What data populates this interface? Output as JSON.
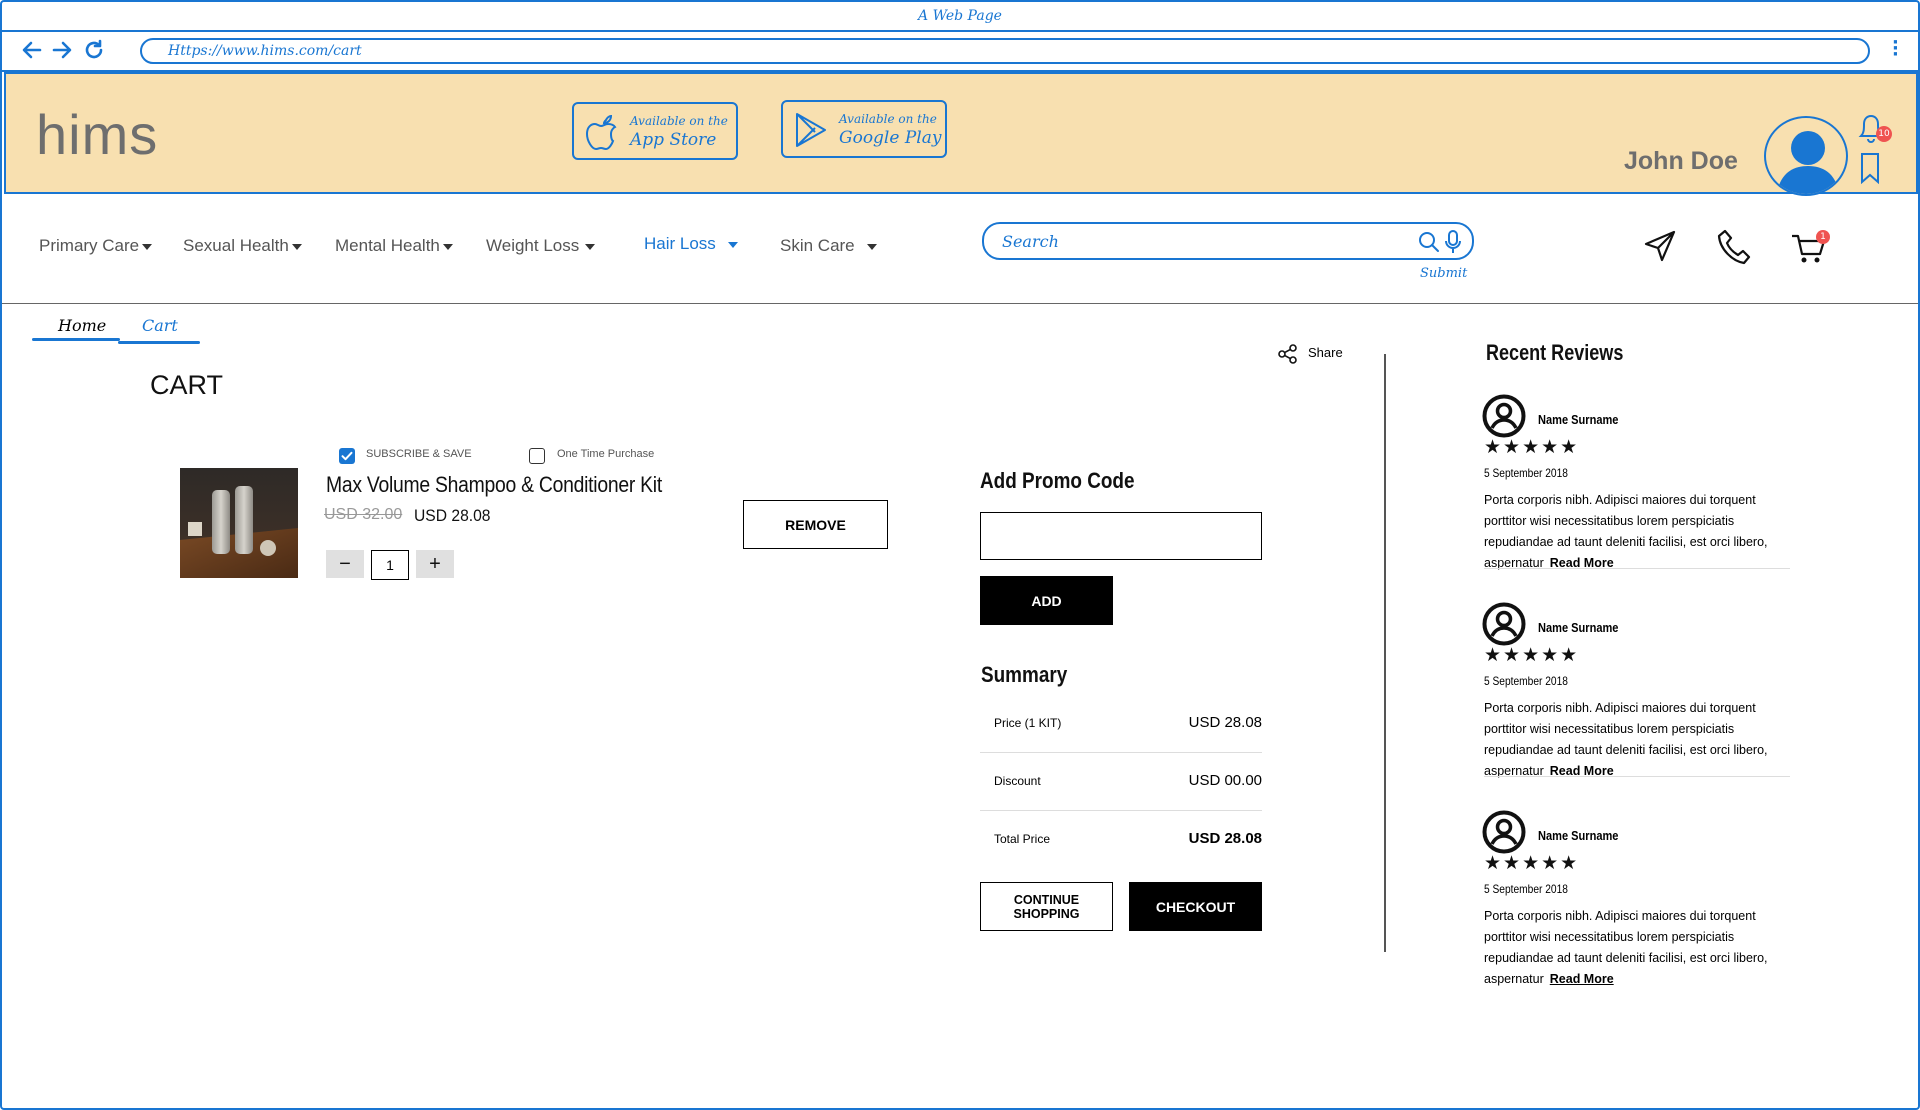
{
  "window": {
    "title": "A Web Page"
  },
  "browser": {
    "url": "Https://www.hims.com/cart"
  },
  "header": {
    "logo": "hims",
    "app_store": {
      "small": "Available on the",
      "big": "App Store"
    },
    "google_play": {
      "small": "Available on the",
      "big": "Google Play"
    },
    "user_name": "John Doe",
    "notification_count": "10"
  },
  "nav": {
    "categories": [
      {
        "label": "Primary Care"
      },
      {
        "label": "Sexual Health"
      },
      {
        "label": "Mental Health"
      },
      {
        "label": "Weight Loss"
      },
      {
        "label": "Hair Loss"
      },
      {
        "label": "Skin Care"
      }
    ],
    "active_category": "Hair Loss",
    "search_placeholder": "Search",
    "submit_label": "Submit",
    "cart_count": "1"
  },
  "breadcrumb": {
    "home": "Home",
    "current": "Cart"
  },
  "cart": {
    "title": "CART",
    "share_label": "Share",
    "item": {
      "subscribe_label": "SUBSCRIBE  & SAVE",
      "subscribe_checked": true,
      "one_time_label": "One Time  Purchase",
      "one_time_checked": false,
      "name": "Max Volume Shampoo & Conditioner Kit",
      "old_price": "USD 32.00",
      "price": "USD 28.08",
      "quantity": "1",
      "minus": "−",
      "plus": "+",
      "remove_label": "REMOVE"
    },
    "promo": {
      "heading": "Add Promo Code",
      "add_label": "ADD"
    },
    "summary": {
      "heading": "Summary",
      "rows": [
        {
          "label": "Price (1 KIT)",
          "value": "USD 28.08"
        },
        {
          "label": "Discount",
          "value": "USD 00.00"
        },
        {
          "label": "Total Price",
          "value": "USD 28.08"
        }
      ],
      "continue_label": "CONTINUE SHOPPING",
      "checkout_label": "CHECKOUT"
    }
  },
  "reviews": {
    "heading": "Recent Reviews",
    "items": [
      {
        "name": "Name Surname",
        "stars": "★★★★★",
        "rating": 5,
        "date": "5 September 2018",
        "text": "Porta corporis nibh. Adipisci maiores dui torquent porttitor wisi necessitatibus lorem perspiciatis repudiandae ad taunt deleniti facilisi, est orci libero, aspernatur",
        "read_more": "Read More"
      },
      {
        "name": "Name Surname",
        "stars": "★★★★★",
        "rating": 5,
        "date": "5 September 2018",
        "text": "Porta corporis nibh. Adipisci maiores dui torquent porttitor wisi necessitatibus lorem perspiciatis repudiandae ad taunt deleniti facilisi, est orci libero, aspernatur",
        "read_more": "Read More"
      },
      {
        "name": "Name Surname",
        "stars": "★★★★★",
        "rating": 5,
        "date": "5 September 2018",
        "text": "Porta corporis nibh. Adipisci maiores dui torquent porttitor wisi necessitatibus lorem perspiciatis repudiandae ad taunt deleniti facilisi, est orci libero, aspernatur",
        "read_more": "Read More"
      }
    ]
  },
  "colors": {
    "accent": "#1976d2",
    "header_bg": "#f8e0b0",
    "badge": "#ef5350",
    "dark_button": "#000000"
  },
  "icons": {
    "back": "arrow-left-icon",
    "forward": "arrow-right-icon",
    "reload": "reload-icon",
    "menu": "kebab-menu-icon",
    "apple": "apple-icon",
    "play": "google-play-icon",
    "bell": "bell-icon",
    "bookmark": "bookmark-icon",
    "search": "search-icon",
    "mic": "microphone-icon",
    "send": "paper-plane-icon",
    "phone": "phone-icon",
    "cart": "shopping-cart-icon",
    "share": "share-icon",
    "reviewer": "user-circle-icon"
  }
}
